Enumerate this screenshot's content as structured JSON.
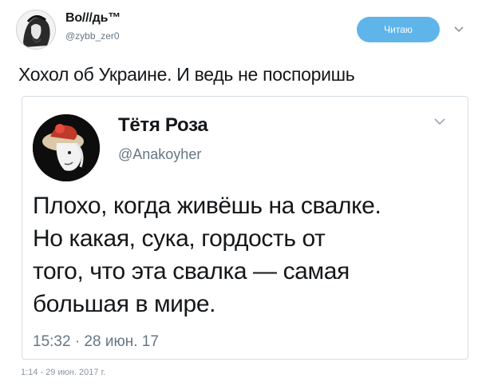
{
  "tweet": {
    "author_name": "Во///дь™",
    "author_handle": "@zybb_zer0",
    "follow_label": "Читаю",
    "text": "Хохол об Украине. И ведь не поспоришь",
    "timestamp": "1:14 - 29 июн. 2017 г."
  },
  "quoted": {
    "author_name": "Тётя Роза",
    "author_handle": "@Anakoyher",
    "lines": [
      "Плохо, когда живёшь на свалке.",
      "Но какая, сука, гордость от",
      "того, что эта свалка — самая",
      "большая в мире."
    ],
    "timestamp": "15:32 · 28 июн. 17"
  },
  "colors": {
    "accent": "#5fb5ea",
    "text": "#14171a",
    "muted": "#657786",
    "border": "#d6dde3"
  }
}
